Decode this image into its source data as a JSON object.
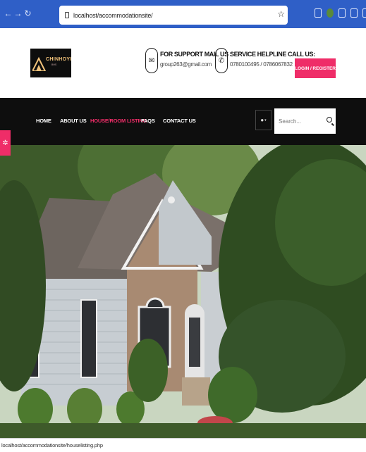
{
  "browser": {
    "url": "localhost/accommodationsite/",
    "status_url": "localhost/accommodationsite/houselisting.php"
  },
  "header": {
    "logo_text": "CHINHOYI",
    "logo_sub": "BHS",
    "support_title": "FOR SUPPORT MAIL US :",
    "support_value": "group263@gmail.com",
    "helpline_title": "SERVICE HELPLINE CALL US:",
    "helpline_value": "0780100495 / 0786067832",
    "login_label": "LOGIN / REGISTER"
  },
  "nav": {
    "items": [
      "HOME",
      "ABOUT US",
      "HOUSE/ROOM LISTING",
      "FAQS",
      "CONTACT US"
    ],
    "active_index": 2,
    "search_placeholder": "Search..."
  },
  "colors": {
    "accent": "#ef2d68",
    "browser_bar": "#2f5fc7",
    "nav_bg": "#0e0e0e"
  }
}
